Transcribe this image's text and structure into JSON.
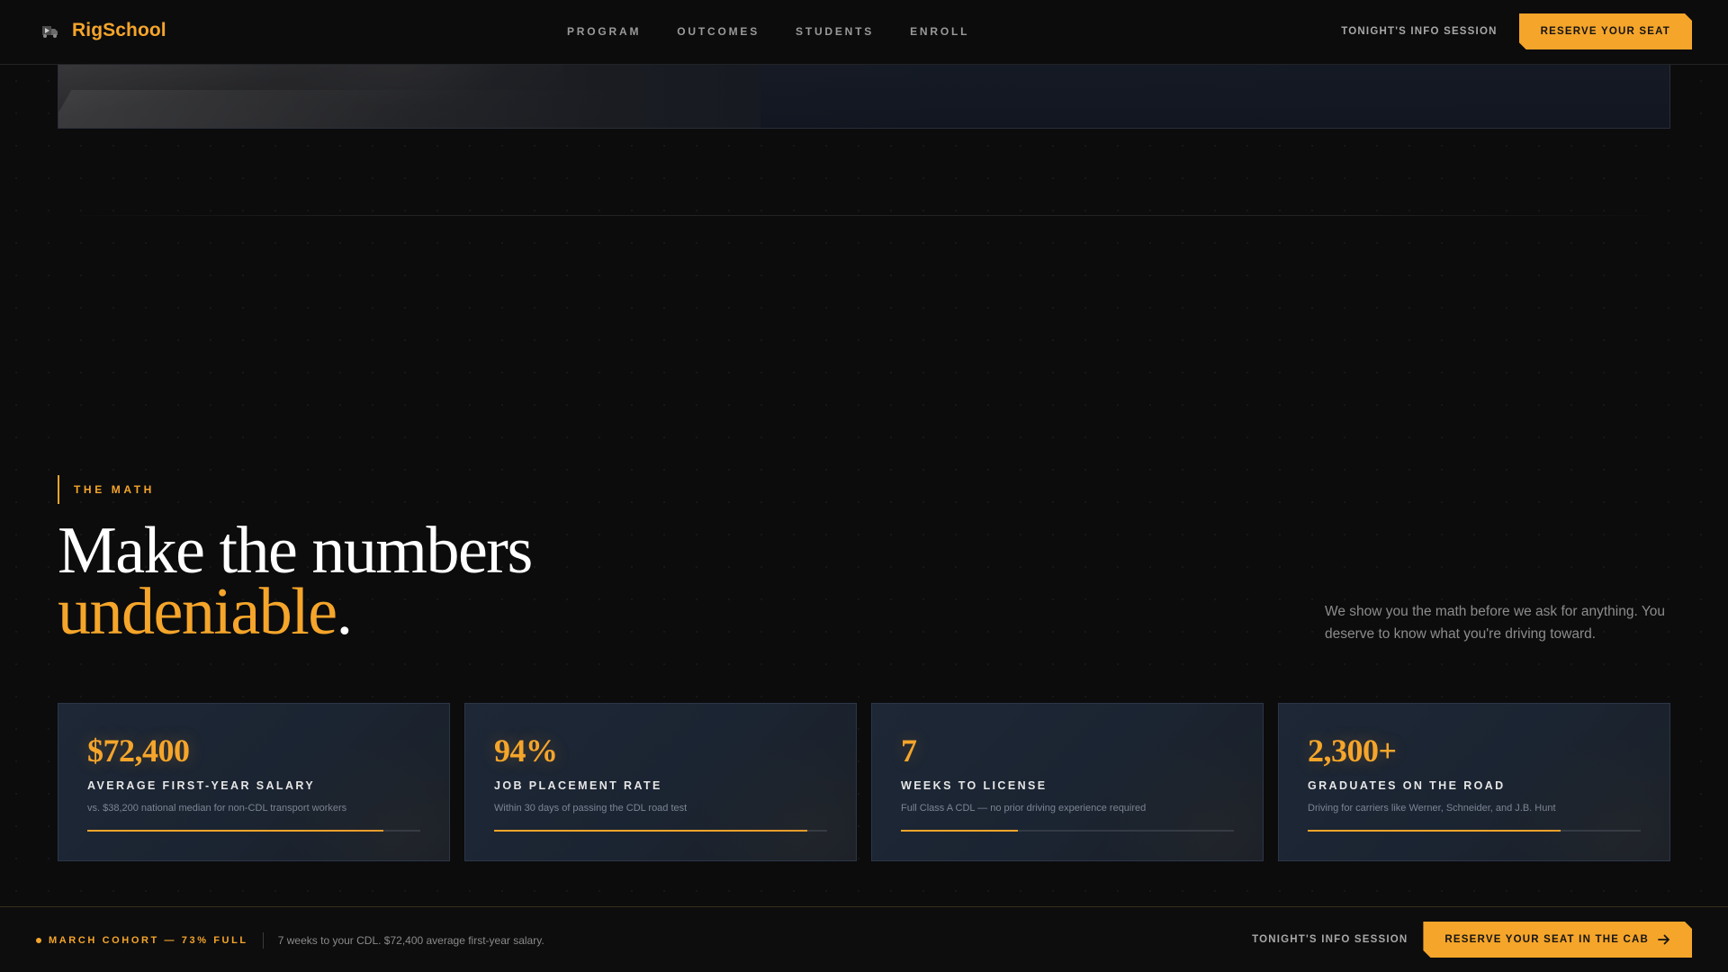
{
  "brand": {
    "name": "RigSchool",
    "logo_icon": "truck-logo-icon"
  },
  "nav": {
    "links": [
      "PROGRAM",
      "OUTCOMES",
      "STUDENTS",
      "ENROLL"
    ],
    "info_session": "TONIGHT'S INFO SESSION",
    "cta": "RESERVE YOUR SEAT"
  },
  "section": {
    "eyebrow": "THE MATH",
    "headline_line1": "Make the numbers",
    "headline_accent": "undeniable",
    "headline_end": ".",
    "lede": "We show you the math before we ask for anything. You deserve to know what you're driving toward."
  },
  "stats": [
    {
      "value": "$72,400",
      "label": "AVERAGE FIRST-YEAR SALARY",
      "note": "vs. $38,200 national median for non-CDL transport workers",
      "progress": 0.89
    },
    {
      "value": "94%",
      "label": "JOB PLACEMENT RATE",
      "note": "Within 30 days of passing the CDL road test",
      "progress": 0.94
    },
    {
      "value": "7",
      "label": "WEEKS TO LICENSE",
      "note": "Full Class A CDL — no prior driving experience required",
      "progress": 0.35
    },
    {
      "value": "2,300+",
      "label": "GRADUATES ON THE ROAD",
      "note": "Driving for carriers like Werner, Schneider, and J.B. Hunt",
      "progress": 0.76
    }
  ],
  "bottom_bar": {
    "cohort": "MARCH COHORT — 73% FULL",
    "message": "7 weeks to your CDL. $72,400 average first-year salary.",
    "info_session": "TONIGHT'S INFO SESSION",
    "cta": "RESERVE YOUR SEAT IN THE CAB",
    "cta_icon": "arrow-right-icon"
  },
  "colors": {
    "accent": "#f5a52a",
    "background": "#0c0c0d",
    "card": "#1d2736"
  }
}
